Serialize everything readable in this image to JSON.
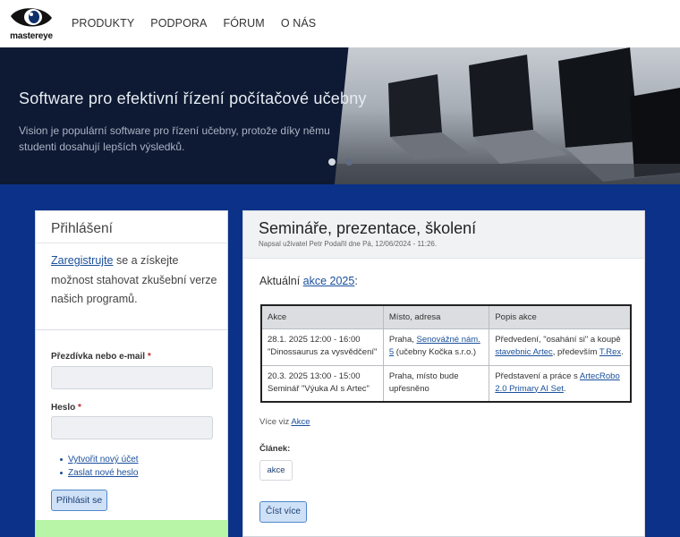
{
  "header": {
    "logo_text": "mastereye",
    "nav": [
      "PRODUKTY",
      "PODPORA",
      "FÓRUM",
      "O NÁS"
    ]
  },
  "banner": {
    "title": "Software pro efektivní řízení počítačové učebny",
    "text": "Vision je populární software pro řízení učebny, protože díky němu studenti dosahují lepších výsledků.",
    "slides_count": 2,
    "active_slide": 1
  },
  "login": {
    "title": "Přihlášení",
    "register_link": "Zaregistrujte",
    "intro_rest": " se a získejte možnost stahovat zkušební verze našich programů.",
    "username_label": "Přezdívka nebo e-mail",
    "password_label": "Heslo",
    "required_mark": "*",
    "links": [
      "Vytvořit nový účet",
      "Zaslat nové heslo"
    ],
    "submit_label": "Přihlásit se"
  },
  "article": {
    "title": "Semináře, prezentace, školení",
    "meta": "Napsal uživatel Petr Podařil dne Pá, 12/06/2024 - 11:26.",
    "aktual_prefix": "Aktuální ",
    "aktual_link": "akce 2025",
    "aktual_suffix": ":",
    "table": {
      "headers": [
        "Akce",
        "Místo, adresa",
        "Popis akce"
      ],
      "rows": [
        {
          "akce_line1": "28.1. 2025 12:00 - 16:00",
          "akce_line2": "\"Dinossaurus za vysvědčení\"",
          "misto_prefix": "Praha, ",
          "misto_link": "Senovážné nám. 5",
          "misto_suffix": " (učebny Kočka s.r.o.)",
          "popis_prefix": "Předvedení, \"osahání si\" a koupě ",
          "popis_link1": "stavebnic Artec",
          "popis_mid": ", především ",
          "popis_link2": "T.Rex",
          "popis_suffix": "."
        },
        {
          "akce_line1": "20.3. 2025 13:00 - 15:00",
          "akce_line2": "Seminář \"Výuka AI s Artec\"",
          "misto_text": "Praha, místo bude upřesněno",
          "popis_prefix": "Představení a práce s ",
          "popis_link": "ArtecRobo 2.0 Primary AI Set",
          "popis_suffix": "."
        }
      ]
    },
    "more_prefix": "Více viz ",
    "more_link": "Akce",
    "clanek_label": "Článek:",
    "tag": "akce",
    "read_more": "Číst více"
  }
}
